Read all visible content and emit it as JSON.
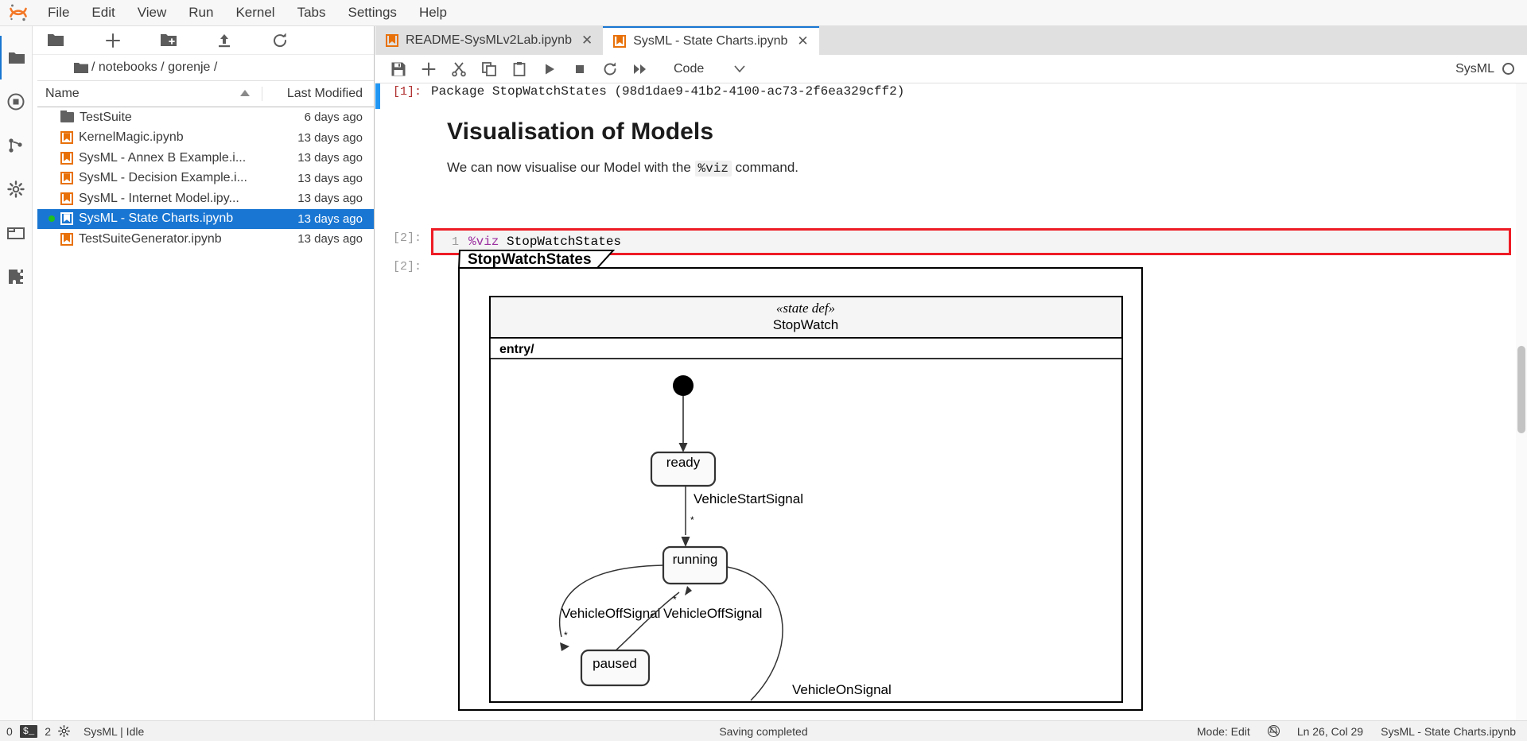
{
  "menubar": {
    "logo": "jupyter-logo",
    "items": [
      "File",
      "Edit",
      "View",
      "Run",
      "Kernel",
      "Tabs",
      "Settings",
      "Help"
    ]
  },
  "activitybar": {
    "items": [
      {
        "name": "file-browser",
        "icon": "folder-icon",
        "selected": true
      },
      {
        "name": "running-terminals",
        "icon": "stop-circle-icon",
        "selected": false
      },
      {
        "name": "git",
        "icon": "git-icon",
        "selected": false
      },
      {
        "name": "property-inspector",
        "icon": "gear-icon",
        "selected": false
      },
      {
        "name": "open-tabs",
        "icon": "tabs-icon",
        "selected": false
      },
      {
        "name": "extension-manager",
        "icon": "puzzle-icon",
        "selected": false
      }
    ]
  },
  "filebrowser": {
    "toolbar": [
      {
        "name": "new-launcher",
        "icon": "plus-icon"
      },
      {
        "name": "new-folder",
        "icon": "new-folder-icon"
      },
      {
        "name": "upload",
        "icon": "upload-icon"
      },
      {
        "name": "refresh",
        "icon": "refresh-icon"
      }
    ],
    "breadcrumb": [
      "/",
      "notebooks",
      "/",
      "gorenje",
      "/"
    ],
    "breadcrumb_text": "/ notebooks / gorenje /",
    "columns": {
      "name": "Name",
      "modified": "Last Modified"
    },
    "sort_indicator": "ascending",
    "rows": [
      {
        "name": "TestSuite",
        "modified": "6 days ago",
        "type": "folder",
        "selected": false,
        "running": false
      },
      {
        "name": "KernelMagic.ipynb",
        "modified": "13 days ago",
        "type": "notebook",
        "selected": false,
        "running": false
      },
      {
        "name": "SysML - Annex B Example.i...",
        "modified": "13 days ago",
        "type": "notebook",
        "selected": false,
        "running": false
      },
      {
        "name": "SysML - Decision Example.i...",
        "modified": "13 days ago",
        "type": "notebook",
        "selected": false,
        "running": false
      },
      {
        "name": "SysML - Internet Model.ipy...",
        "modified": "13 days ago",
        "type": "notebook",
        "selected": false,
        "running": false
      },
      {
        "name": "SysML - State Charts.ipynb",
        "modified": "13 days ago",
        "type": "notebook",
        "selected": true,
        "running": true
      },
      {
        "name": "TestSuiteGenerator.ipynb",
        "modified": "13 days ago",
        "type": "notebook",
        "selected": false,
        "running": false
      }
    ]
  },
  "tabs": [
    {
      "label": "README-SysMLv2Lab.ipynb",
      "active": false,
      "close": "✕"
    },
    {
      "label": "SysML - State Charts.ipynb",
      "active": true,
      "close": "✕"
    }
  ],
  "notebook_toolbar": {
    "buttons": [
      {
        "name": "save-button",
        "icon": "save-icon"
      },
      {
        "name": "insert-cell-button",
        "icon": "plus-icon"
      },
      {
        "name": "cut-cells-button",
        "icon": "scissors-icon"
      },
      {
        "name": "copy-cells-button",
        "icon": "copy-icon"
      },
      {
        "name": "paste-cells-button",
        "icon": "paste-icon"
      },
      {
        "name": "run-cell-button",
        "icon": "play-icon"
      },
      {
        "name": "interrupt-kernel-button",
        "icon": "stop-icon"
      },
      {
        "name": "restart-kernel-button",
        "icon": "restart-icon"
      },
      {
        "name": "restart-and-run-all-button",
        "icon": "fast-forward-icon"
      }
    ],
    "cell_type": "Code",
    "cell_type_caret": "▾",
    "kernel_name": "SysML",
    "kernel_status_icon": "idle-circle-icon"
  },
  "notebook": {
    "output_1_prompt": "[1]:",
    "output_1_text": "Package StopWatchStates (98d1dae9-41b2-4100-ac73-2f6ea329cff2)",
    "markdown_heading": "Visualisation of Models",
    "markdown_para_before": "We can now visualise our Model with the ",
    "markdown_para_code": "%viz",
    "markdown_para_after": " command.",
    "code_cell_prompt": "[2]:",
    "code_cell_line_number": "1",
    "code_cell_magic": "%viz",
    "code_cell_arg": " StopWatchStates",
    "highlight_color": "#ee1c25",
    "output_2_prompt": "[2]:"
  },
  "diagram": {
    "package_label": "StopWatchStates",
    "state_def_stereotype": "«state def»",
    "state_def_name": "StopWatch",
    "compartment_label": "entry/",
    "states": [
      {
        "id": "initial",
        "label": "",
        "type": "initial-node"
      },
      {
        "id": "ready",
        "label": "ready",
        "type": "state"
      },
      {
        "id": "running",
        "label": "running",
        "type": "state"
      },
      {
        "id": "paused",
        "label": "paused",
        "type": "state"
      }
    ],
    "transitions": [
      {
        "from": "initial",
        "to": "ready",
        "label": "",
        "multiplicity": ""
      },
      {
        "from": "ready",
        "to": "running",
        "label": "VehicleStartSignal",
        "multiplicity": "*"
      },
      {
        "from": "running",
        "to": "paused",
        "label": "VehicleOffSignal",
        "multiplicity": "*"
      },
      {
        "from": "paused",
        "to": "running",
        "label": "VehicleOffSignal",
        "multiplicity": "*"
      },
      {
        "from": "running",
        "to": "off",
        "label": "VehicleOnSignal",
        "multiplicity": ""
      }
    ]
  },
  "statusbar": {
    "left_count": "0",
    "left_chip": "$_",
    "left_kernels": "2",
    "left_gear_icon": "settings-icon",
    "kernel_text": "SysML | Idle",
    "center_text": "Saving completed",
    "mode_text": "Mode: Edit",
    "notif_icon": "notification-off-icon",
    "position_text": "Ln 26, Col 29",
    "file_text": "SysML - State Charts.ipynb"
  }
}
